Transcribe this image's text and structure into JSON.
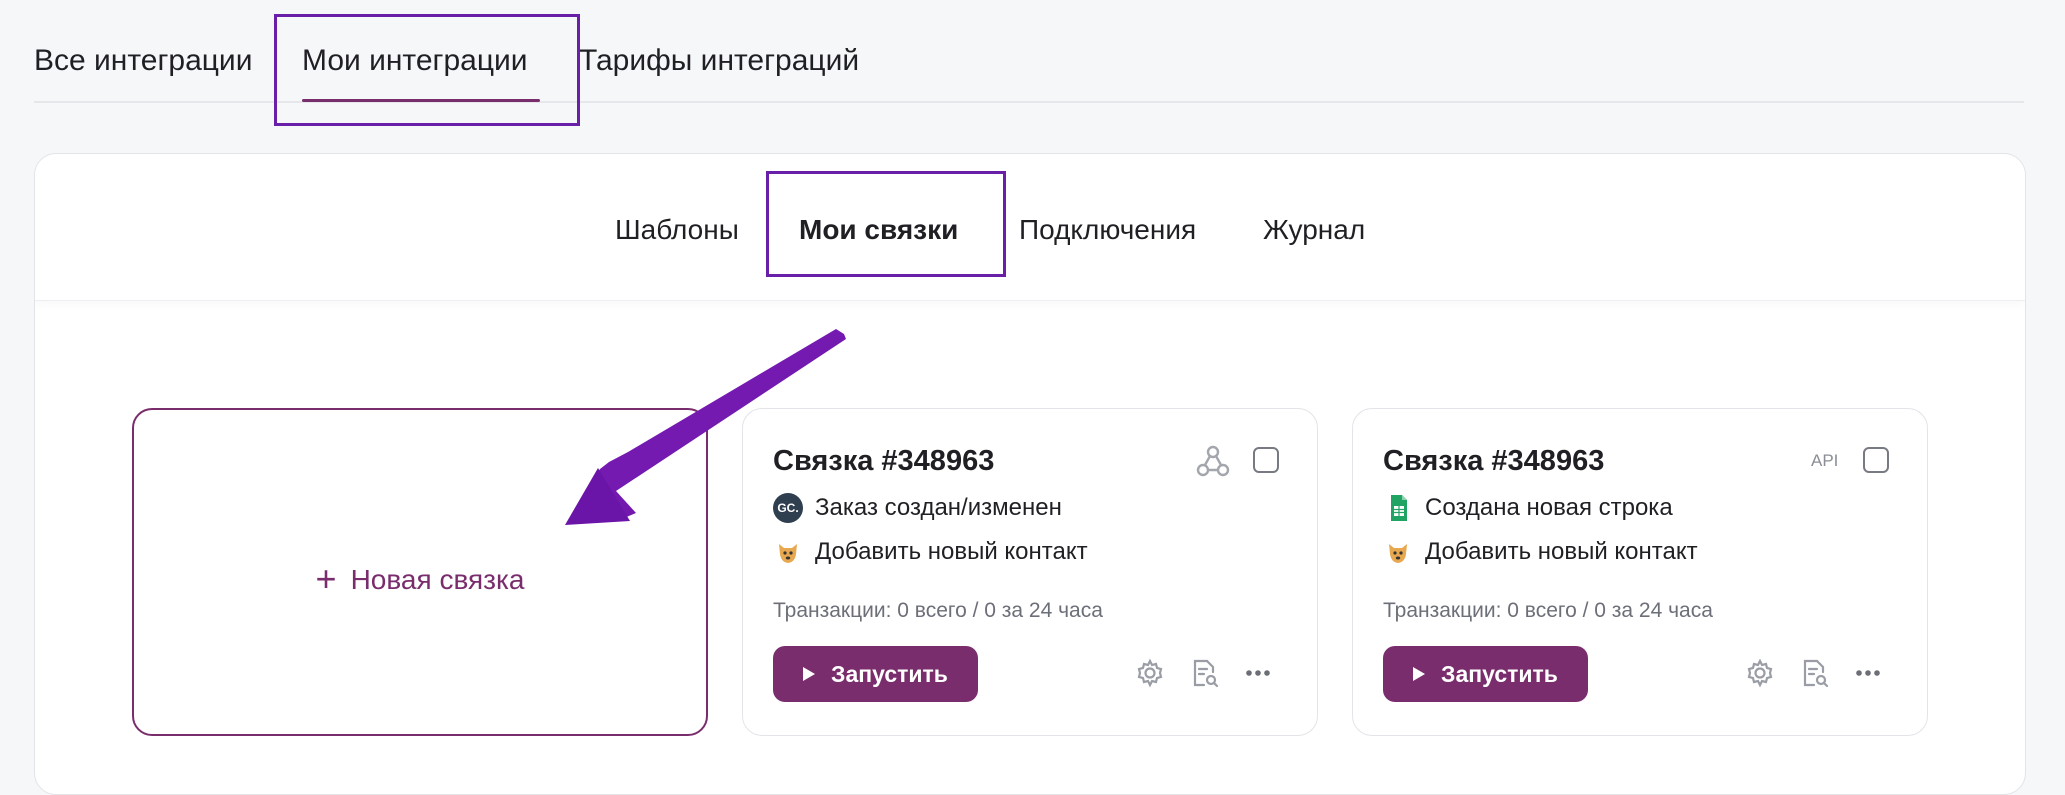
{
  "top_tabs": {
    "all": "Все интеграции",
    "mine": "Мои интеграции",
    "tariffs": "Тарифы интеграций"
  },
  "sub_tabs": {
    "templates": "Шаблоны",
    "my_links": "Мои связки",
    "connections": "Подключения",
    "journal": "Журнал"
  },
  "new_link": {
    "icon": "+",
    "label": "Новая связка"
  },
  "cards": [
    {
      "title": "Связка #348963",
      "type_icon": "webhook-icon",
      "trigger_badge": "GC.",
      "trigger": "Заказ создан/изменен",
      "action": "Добавить новый контакт",
      "stats": "Транзакции: 0 всего / 0 за 24 часа",
      "run_label": "Запустить"
    },
    {
      "title": "Связка #348963",
      "type_label": "API",
      "trigger": "Создана новая строка",
      "action": "Добавить новый контакт",
      "stats": "Транзакции: 0 всего / 0 за 24 часа",
      "run_label": "Запустить"
    }
  ],
  "colors": {
    "accent": "#7a2d6d",
    "highlight": "#6a1fa8",
    "arrow": "#7d1fb8"
  }
}
